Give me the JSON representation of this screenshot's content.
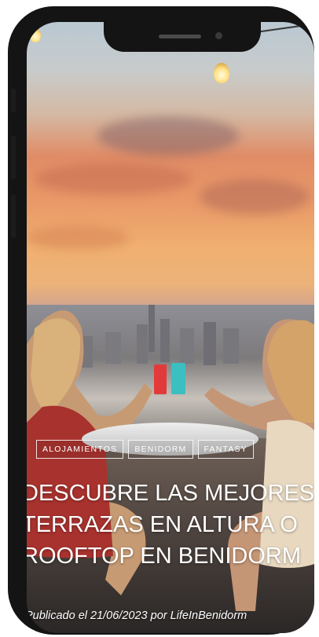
{
  "post": {
    "categories": [
      "ALOJAMIENTOS",
      "BENIDORM",
      "FANTASY"
    ],
    "title_lines": [
      "DESCUBRE LAS MEJORES",
      "TERRAZAS EN ALTURA O",
      "ROOFTOP EN BENIDORM"
    ],
    "meta": "Publicado el 21/06/2023 por LifeInBenidorm"
  }
}
